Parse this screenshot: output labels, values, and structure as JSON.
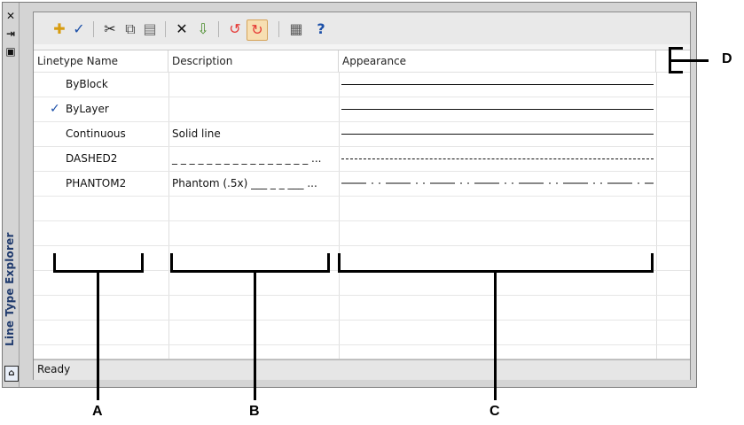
{
  "window": {
    "side_title": "Line Type Explorer",
    "close_symbol": "✕",
    "dock_symbol": "⇥",
    "panel_symbol": "▣"
  },
  "toolbar": {
    "icons": [
      "new-linetype-icon",
      "set-current-icon",
      "cut-icon",
      "copy-icon",
      "paste-icon",
      "delete-icon",
      "load-icon",
      "sync-red-icon",
      "sync-active-icon",
      "details-view-icon",
      "help-icon"
    ]
  },
  "table": {
    "headers": [
      "Linetype Name",
      "Description",
      "Appearance"
    ],
    "rows": [
      {
        "name": "ByBlock",
        "description": "",
        "appearance": "solid",
        "checked": false
      },
      {
        "name": "ByLayer",
        "description": "",
        "appearance": "solid",
        "checked": true
      },
      {
        "name": "Continuous",
        "description": "Solid line",
        "appearance": "solid",
        "checked": false
      },
      {
        "name": "DASHED2",
        "description": "_ _ _ _ _ _ _ _ _ _ _ _ _ _ _ _ ...",
        "appearance": "dashed",
        "checked": false
      },
      {
        "name": "PHANTOM2",
        "description": "Phantom (.5x) ___ _ _ ___ ...",
        "appearance": "phantom",
        "checked": false
      }
    ]
  },
  "status": {
    "text": "Ready"
  },
  "callouts": {
    "a": "A",
    "b": "B",
    "c": "C",
    "d": "D"
  }
}
